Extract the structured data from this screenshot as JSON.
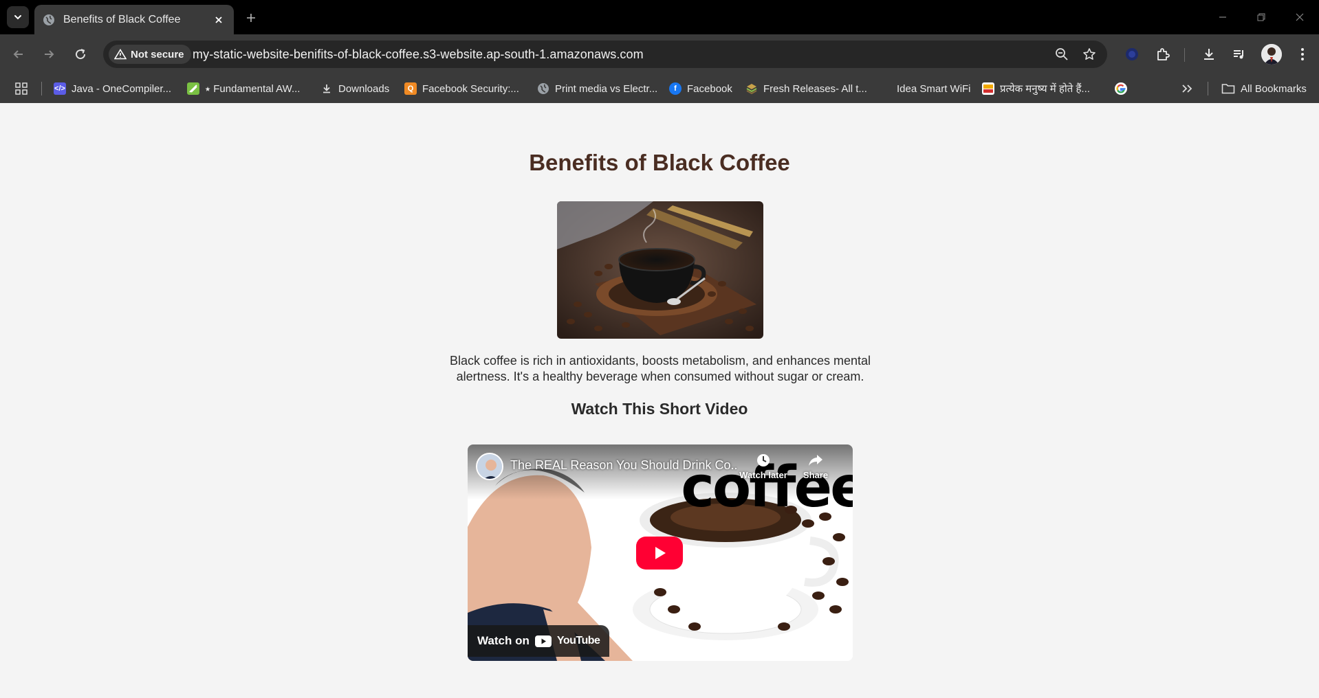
{
  "browser": {
    "tab": {
      "title": "Benefits of Black Coffee"
    },
    "omnibox": {
      "security_label": "Not secure",
      "url": "my-static-website-benifits-of-black-coffee.s3-website.ap-south-1.amazonaws.com"
    },
    "bookmarks": [
      {
        "label": "Java - OneCompiler...",
        "icon": "onecompiler-icon",
        "color": "#5b5ce6"
      },
      {
        "label": "⭑ Fundamental AW...",
        "icon": "aws-leaf-icon",
        "color": "#7ac143"
      },
      {
        "label": "Downloads",
        "icon": "download-icon",
        "color": "#cccccc"
      },
      {
        "label": "Facebook Security:...",
        "icon": "q-icon",
        "color": "#f08a24"
      },
      {
        "label": "Print media vs Electr...",
        "icon": "globe-icon",
        "color": "#cccccc"
      },
      {
        "label": "Facebook",
        "icon": "facebook-icon",
        "color": "#1877f2"
      },
      {
        "label": "Fresh Releases- All t...",
        "icon": "stack-icon",
        "color": "#8a6d3b"
      },
      {
        "label": "Idea Smart WiFi",
        "icon": "",
        "color": ""
      },
      {
        "label": "प्रत्येक मनुष्य में होते हैं...",
        "icon": "news-icon",
        "color": "#f2a900"
      },
      {
        "label": "",
        "icon": "google-icon",
        "color": "#4285f4"
      }
    ],
    "all_bookmarks_label": "All Bookmarks"
  },
  "page": {
    "heading": "Benefits of Black Coffee",
    "image_alt": "Cup of black coffee with coffee beans",
    "paragraph": "Black coffee is rich in antioxidants, boosts metabolism, and enhances mental alertness. It's a healthy beverage when consumed without sugar or cream.",
    "subheading": "Watch This Short Video",
    "video": {
      "title": "The REAL Reason You Should Drink Co...",
      "watch_later": "Watch later",
      "share": "Share",
      "overlay_word": "coffee",
      "watch_on": "Watch on",
      "youtube": "YouTube"
    }
  },
  "colors": {
    "heading": "#4a2d22",
    "play_button": "#ff0033",
    "page_bg": "#f4f4f4"
  }
}
